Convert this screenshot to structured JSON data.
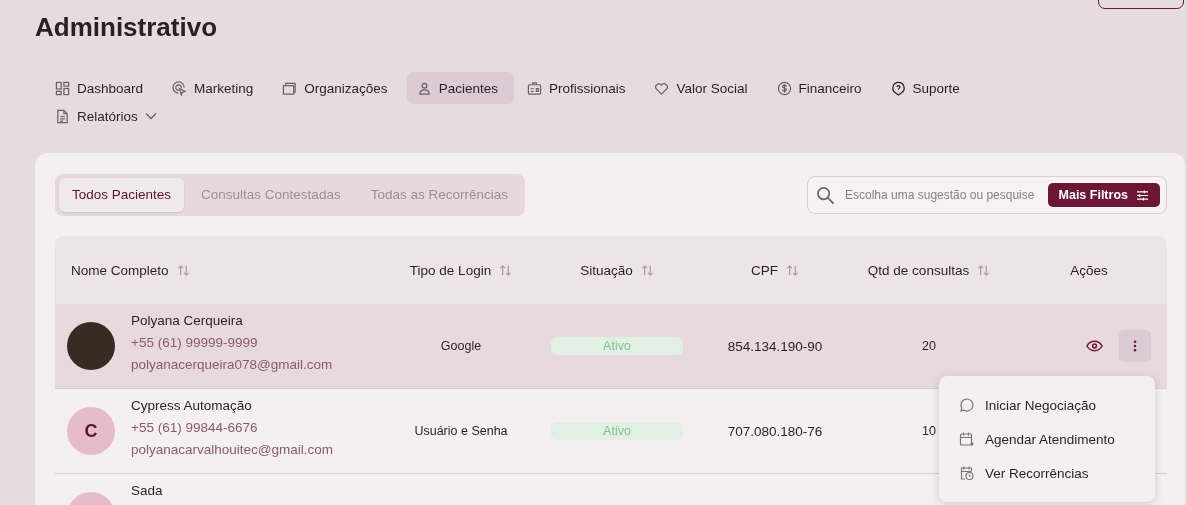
{
  "page": {
    "title": "Administrativo"
  },
  "nav": [
    {
      "label": "Dashboard",
      "selected": false,
      "dropdown": false
    },
    {
      "label": "Marketing",
      "selected": false,
      "dropdown": false
    },
    {
      "label": "Organizações",
      "selected": false,
      "dropdown": false
    },
    {
      "label": "Pacientes",
      "selected": true,
      "dropdown": false
    },
    {
      "label": "Profissionais",
      "selected": false,
      "dropdown": false
    },
    {
      "label": "Valor Social",
      "selected": false,
      "dropdown": false
    },
    {
      "label": "Financeiro",
      "selected": false,
      "dropdown": false
    },
    {
      "label": "Suporte",
      "selected": false,
      "dropdown": false
    },
    {
      "label": "Relatórios",
      "selected": false,
      "dropdown": true
    }
  ],
  "tabs": [
    {
      "label": "Todos Pacientes",
      "selected": true
    },
    {
      "label": "Consultas Contestadas",
      "selected": false
    },
    {
      "label": "Todas as Recorrências",
      "selected": false
    }
  ],
  "search": {
    "placeholder": "Escolha uma sugestão ou pesquise",
    "button": "Mais Filtros"
  },
  "table": {
    "columns": [
      "Nome Completo",
      "Tipo de Login",
      "Situação",
      "CPF",
      "Qtd de consultas",
      "Ações"
    ],
    "rows": [
      {
        "name": "Polyana Cerqueira",
        "phone": "+55 (61) 99999-9999",
        "email": "polyanacerqueira078@gmail.com",
        "avatar": {
          "kind": "photo"
        },
        "login": "Google",
        "status": "Ativo",
        "cpf": "854.134.190-90",
        "consultas": "20",
        "selected": true,
        "actions": true,
        "menu_open": true
      },
      {
        "name": "Cypress Automação",
        "phone": "+55 (61) 99844-6676",
        "email": "polyanacarvalhouitec@gmail.com",
        "avatar": {
          "kind": "initial",
          "text": "C"
        },
        "login": "Usuário e Senha",
        "status": "Ativo",
        "cpf": "707.080.180-76",
        "consultas": "10",
        "selected": false,
        "actions": false
      },
      {
        "name": "Sada",
        "avatar": {
          "kind": "initial"
        },
        "selected": false,
        "actions": false
      }
    ]
  },
  "row_menu": [
    {
      "label": "Iniciar Negociação"
    },
    {
      "label": "Agendar Atendimento"
    },
    {
      "label": "Ver Recorrências"
    }
  ]
}
